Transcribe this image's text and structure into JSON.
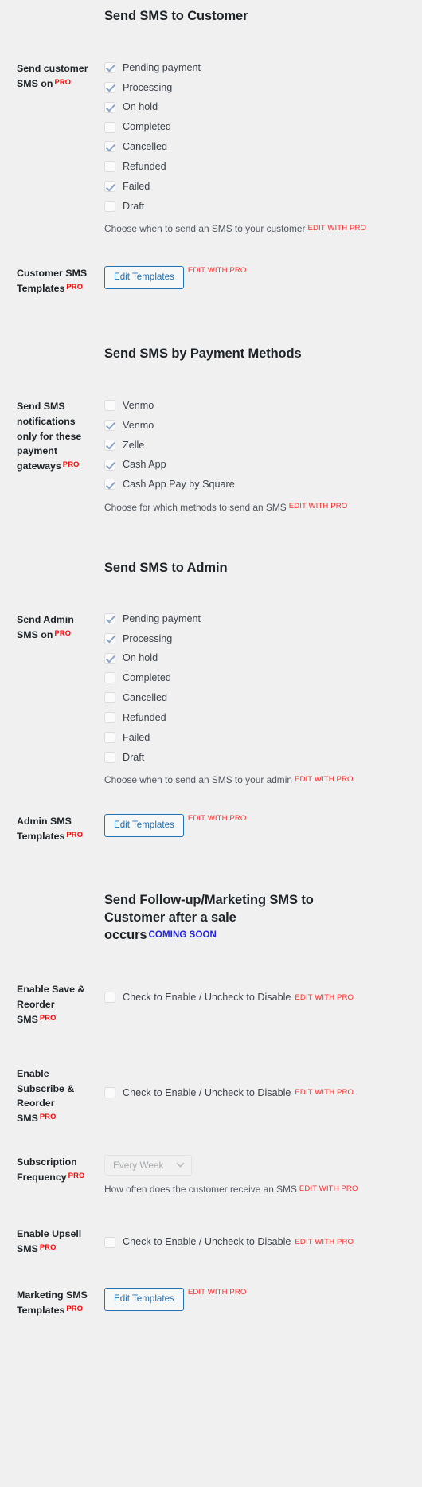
{
  "badges": {
    "pro": "PRO",
    "edit_with_pro": "EDIT WITH PRO",
    "coming_soon": "COMING SOON"
  },
  "colors": {
    "pro": "#ff0000",
    "edit_pro": "#ff2b2b",
    "coming_soon": "#2222dd",
    "accent": "#2271b1",
    "background": "#f0f0f1",
    "check": "#8da4c4"
  },
  "sections": {
    "customer": {
      "heading": "Send SMS to Customer",
      "send_on": {
        "label": "Send customer SMS on",
        "statuses": [
          {
            "label": "Pending payment",
            "checked": true
          },
          {
            "label": "Processing",
            "checked": true
          },
          {
            "label": "On hold",
            "checked": true
          },
          {
            "label": "Completed",
            "checked": false
          },
          {
            "label": "Cancelled",
            "checked": true
          },
          {
            "label": "Refunded",
            "checked": false
          },
          {
            "label": "Failed",
            "checked": true
          },
          {
            "label": "Draft",
            "checked": false
          }
        ],
        "description": "Choose when to send an SMS to your customer"
      },
      "templates": {
        "label": "Customer SMS Templates",
        "button": "Edit Templates"
      }
    },
    "payment_methods": {
      "heading": "Send SMS by Payment Methods",
      "gateways_field": {
        "label": "Send SMS notifications only for these payment gateways",
        "gateways": [
          {
            "label": "Venmo",
            "checked": false
          },
          {
            "label": "Venmo",
            "checked": true
          },
          {
            "label": "Zelle",
            "checked": true
          },
          {
            "label": "Cash App",
            "checked": true
          },
          {
            "label": "Cash App Pay by Square",
            "checked": true
          }
        ],
        "description": "Choose for which methods to send an SMS"
      }
    },
    "admin": {
      "heading": "Send SMS to Admin",
      "send_on": {
        "label": "Send Admin SMS on",
        "statuses": [
          {
            "label": "Pending payment",
            "checked": true
          },
          {
            "label": "Processing",
            "checked": true
          },
          {
            "label": "On hold",
            "checked": true
          },
          {
            "label": "Completed",
            "checked": false
          },
          {
            "label": "Cancelled",
            "checked": false
          },
          {
            "label": "Refunded",
            "checked": false
          },
          {
            "label": "Failed",
            "checked": false
          },
          {
            "label": "Draft",
            "checked": false
          }
        ],
        "description": "Choose when to send an SMS to your admin"
      },
      "templates": {
        "label": "Admin SMS Templates",
        "button": "Edit Templates"
      }
    },
    "marketing": {
      "heading": "Send Follow-up/Marketing SMS to Customer after a sale occurs",
      "save_reorder": {
        "label": "Enable Save & Reorder SMS",
        "checkbox_label": "Check to Enable / Uncheck to Disable",
        "checked": false
      },
      "subscribe_reorder": {
        "label": "Enable Subscribe & Reorder SMS",
        "checkbox_label": "Check to Enable / Uncheck to Disable",
        "checked": false
      },
      "subscription_frequency": {
        "label": "Subscription Frequency",
        "value": "Every Week",
        "description": "How often does the customer receive an SMS"
      },
      "upsell": {
        "label": "Enable Upsell SMS",
        "checkbox_label": "Check to Enable / Uncheck to Disable",
        "checked": false
      },
      "templates": {
        "label": "Marketing SMS Templates",
        "button": "Edit Templates"
      }
    }
  }
}
